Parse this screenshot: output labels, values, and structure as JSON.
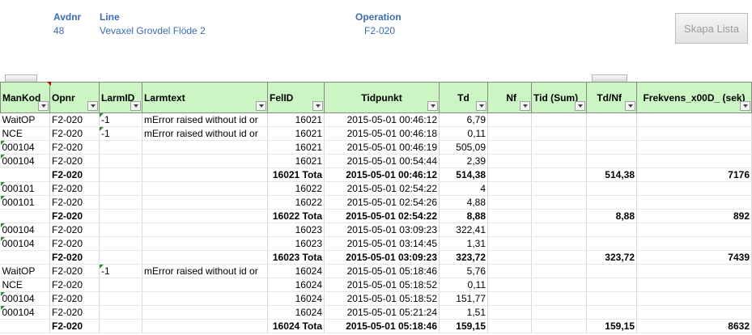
{
  "header": {
    "avdnr_label": "Avdnr",
    "avdnr_value": "48",
    "line_label": "Line",
    "line_value": "Vevaxel Grovdel Flöde 2",
    "operation_label": "Operation",
    "operation_value": "F2-020",
    "button_label": "Skapa Lista"
  },
  "columns": [
    "ManKod",
    "Opnr",
    "LarmID",
    "Larmtext",
    "FelID",
    "Tidpunkt",
    "Td",
    "Nf",
    "Tid (Sum)",
    "Td/Nf",
    "Frekvens_x00D_ (sek)"
  ],
  "rows": [
    {
      "type": "data",
      "flag": [
        false,
        false,
        true
      ],
      "cells": [
        "WaitOP",
        "F2-020",
        "-1",
        "mError raised without id or",
        "16021",
        "2015-05-01 00:46:12",
        "6,79",
        "",
        "",
        "",
        ""
      ]
    },
    {
      "type": "data",
      "flag": [
        false,
        false,
        true
      ],
      "cells": [
        "NCE",
        "F2-020",
        "-1",
        "mError raised without id or",
        "16021",
        "2015-05-01 00:46:18",
        "0,11",
        "",
        "",
        "",
        ""
      ]
    },
    {
      "type": "data",
      "flag": [
        true,
        false,
        false
      ],
      "cells": [
        "000104",
        "F2-020",
        "",
        "",
        "16021",
        "2015-05-01 00:46:19",
        "505,09",
        "",
        "",
        "",
        ""
      ]
    },
    {
      "type": "data",
      "flag": [
        true,
        false,
        false
      ],
      "cells": [
        "000104",
        "F2-020",
        "",
        "",
        "16021",
        "2015-05-01 00:54:44",
        "2,39",
        "",
        "",
        "",
        ""
      ]
    },
    {
      "type": "total",
      "flag": [
        false,
        false,
        false
      ],
      "cells": [
        "",
        "F2-020",
        "",
        "",
        "16021 Tota",
        "2015-05-01 00:46:12",
        "514,38",
        "",
        "",
        "514,38",
        "7176"
      ]
    },
    {
      "type": "data",
      "flag": [
        true,
        false,
        false
      ],
      "cells": [
        "000101",
        "F2-020",
        "",
        "",
        "16022",
        "2015-05-01 02:54:22",
        "4",
        "",
        "",
        "",
        ""
      ]
    },
    {
      "type": "data",
      "flag": [
        true,
        false,
        false
      ],
      "cells": [
        "000101",
        "F2-020",
        "",
        "",
        "16022",
        "2015-05-01 02:54:26",
        "4,88",
        "",
        "",
        "",
        ""
      ]
    },
    {
      "type": "total",
      "flag": [
        false,
        false,
        false
      ],
      "cells": [
        "",
        "F2-020",
        "",
        "",
        "16022 Tota",
        "2015-05-01 02:54:22",
        "8,88",
        "",
        "",
        "8,88",
        "892"
      ]
    },
    {
      "type": "data",
      "flag": [
        true,
        false,
        false
      ],
      "cells": [
        "000104",
        "F2-020",
        "",
        "",
        "16023",
        "2015-05-01 03:09:23",
        "322,41",
        "",
        "",
        "",
        ""
      ]
    },
    {
      "type": "data",
      "flag": [
        true,
        false,
        false
      ],
      "cells": [
        "000104",
        "F2-020",
        "",
        "",
        "16023",
        "2015-05-01 03:14:45",
        "1,31",
        "",
        "",
        "",
        ""
      ]
    },
    {
      "type": "total",
      "flag": [
        false,
        false,
        false
      ],
      "cells": [
        "",
        "F2-020",
        "",
        "",
        "16023 Tota",
        "2015-05-01 03:09:23",
        "323,72",
        "",
        "",
        "323,72",
        "7439"
      ]
    },
    {
      "type": "data",
      "flag": [
        false,
        false,
        true
      ],
      "cells": [
        "WaitOP",
        "F2-020",
        "-1",
        "mError raised without id or",
        "16024",
        "2015-05-01 05:18:46",
        "5,76",
        "",
        "",
        "",
        ""
      ]
    },
    {
      "type": "data",
      "flag": [
        false,
        false,
        false
      ],
      "cells": [
        "NCE",
        "F2-020",
        "",
        "",
        "16024",
        "2015-05-01 05:18:52",
        "0,11",
        "",
        "",
        "",
        ""
      ]
    },
    {
      "type": "data",
      "flag": [
        true,
        false,
        false
      ],
      "cells": [
        "000104",
        "F2-020",
        "",
        "",
        "16024",
        "2015-05-01 05:18:52",
        "151,77",
        "",
        "",
        "",
        ""
      ]
    },
    {
      "type": "data",
      "flag": [
        true,
        false,
        false
      ],
      "cells": [
        "000104",
        "F2-020",
        "",
        "",
        "16024",
        "2015-05-01 05:21:24",
        "1,51",
        "",
        "",
        "",
        ""
      ]
    },
    {
      "type": "total",
      "flag": [
        false,
        false,
        false
      ],
      "cells": [
        "",
        "F2-020",
        "",
        "",
        "16024 Tota",
        "2015-05-01 05:18:46",
        "159,15",
        "",
        "",
        "159,15",
        "8632"
      ]
    }
  ]
}
